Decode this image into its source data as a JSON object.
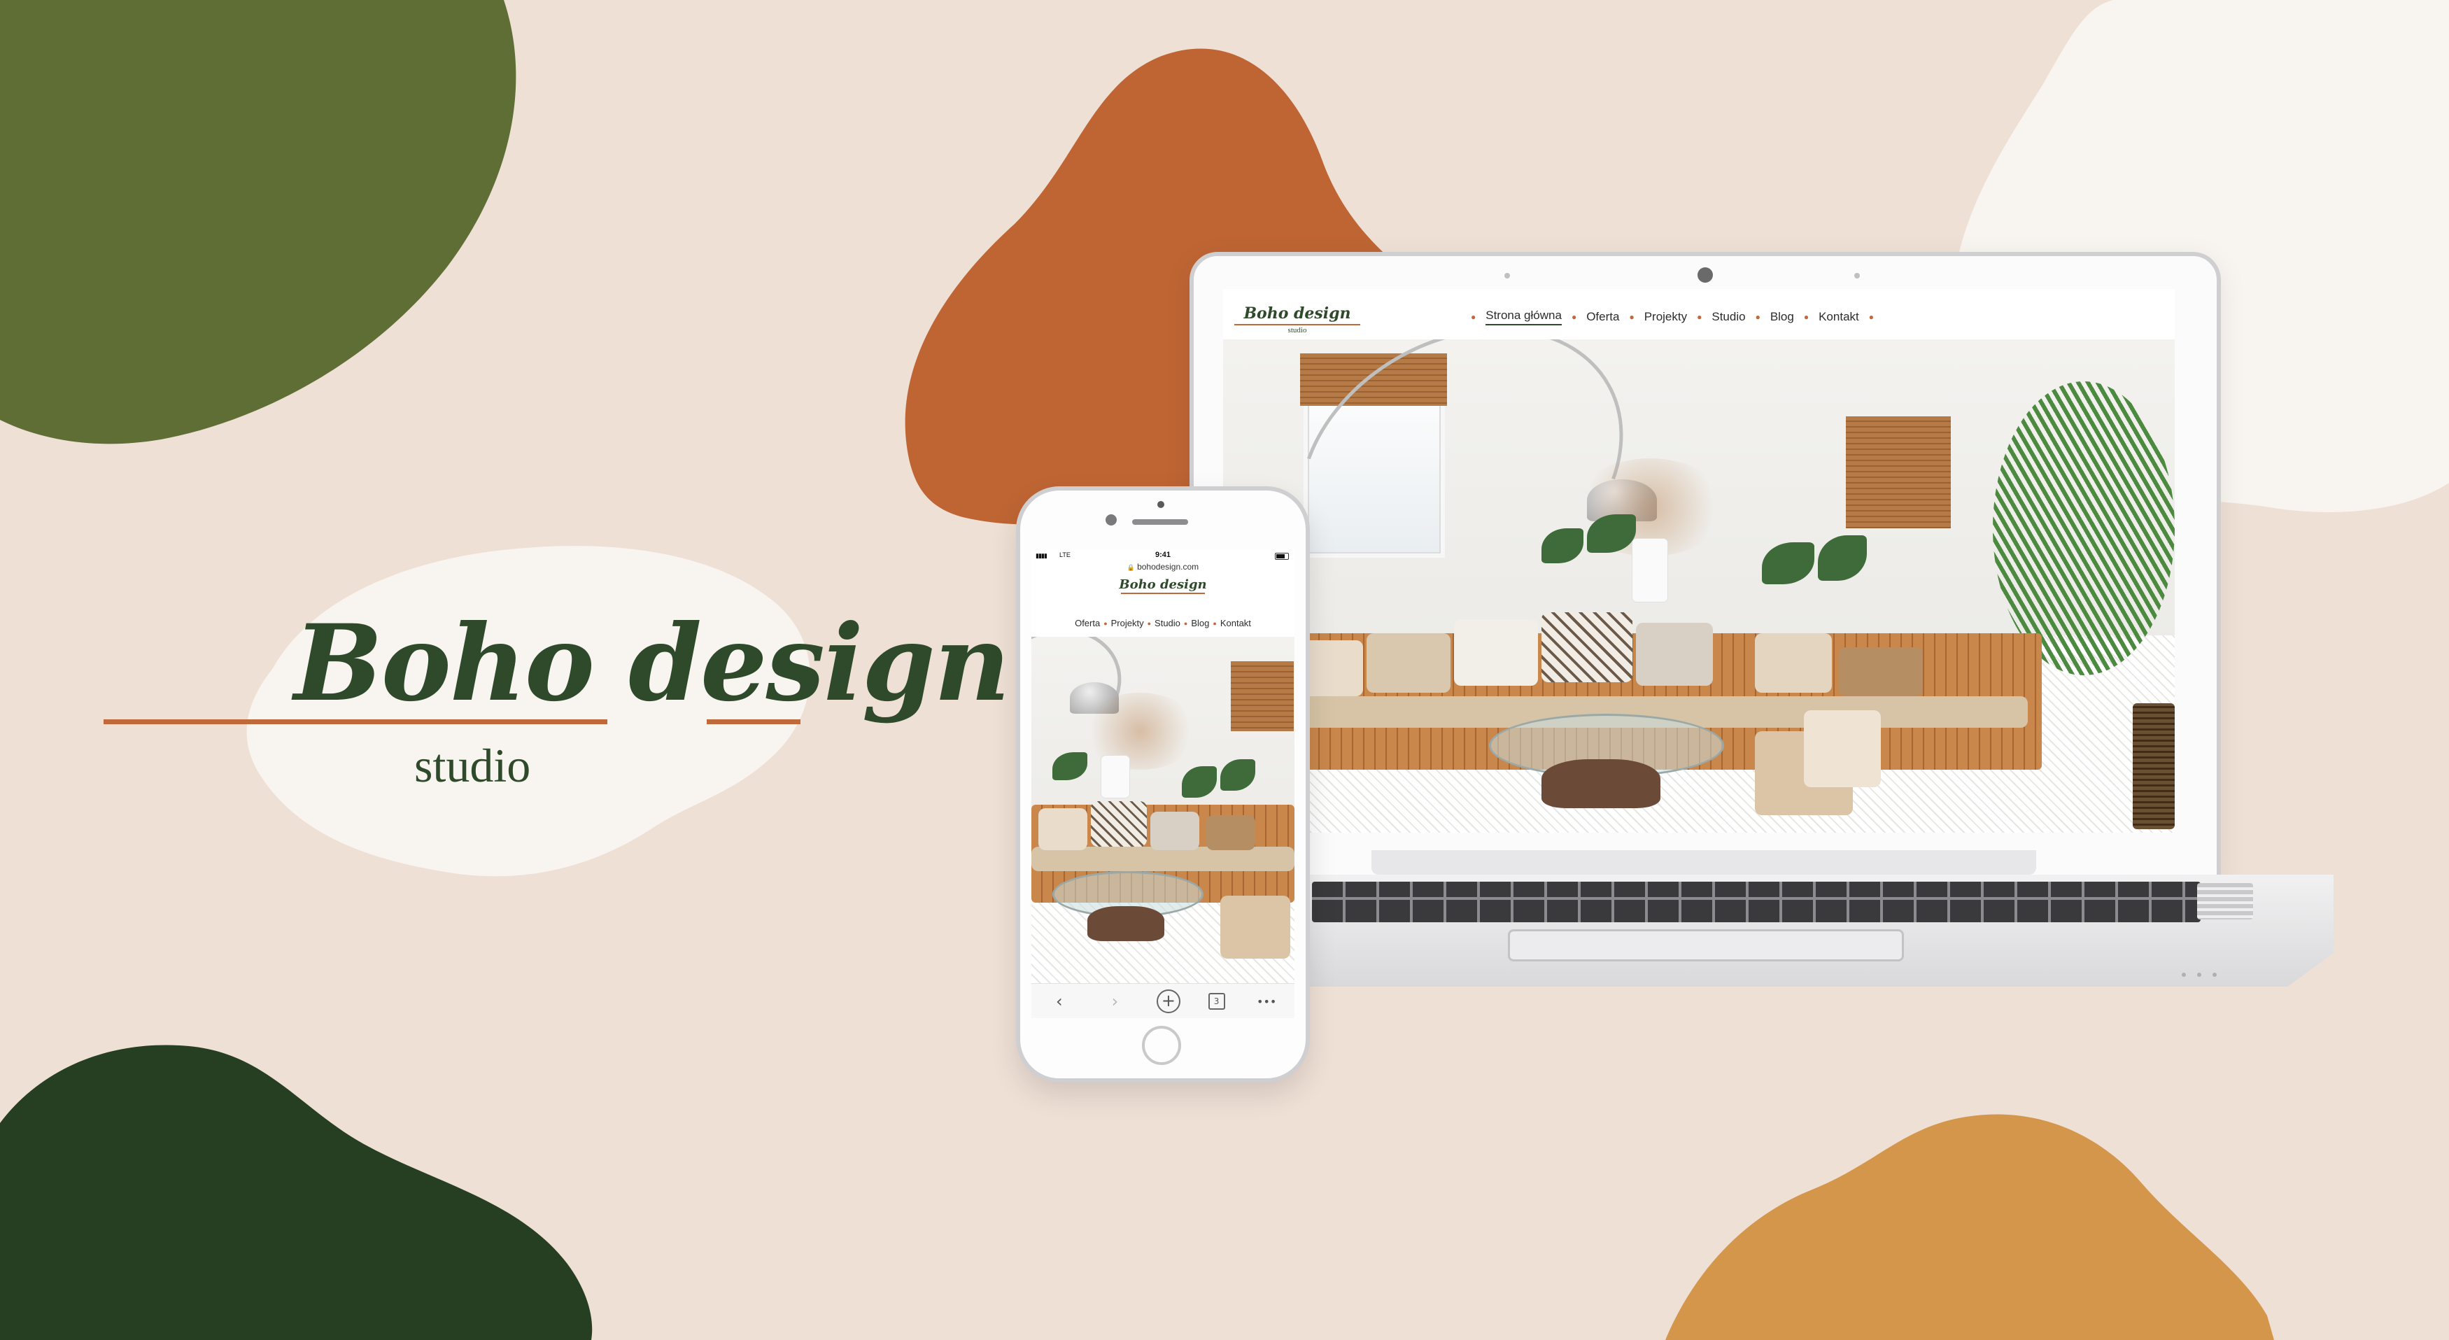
{
  "brand": {
    "name": "Boho design",
    "tagline": "studio",
    "colors": {
      "background": "#efe0d5",
      "olive": "#5f6e35",
      "forest": "#263f22",
      "rust": "#bf6534",
      "ochre": "#d4964b",
      "cream": "#f8f4ef",
      "accent_line": "#c0693a"
    }
  },
  "laptop_site": {
    "logo_title": "Boho design",
    "logo_subtitle": "studio",
    "nav": [
      {
        "label": "Strona główna",
        "active": true
      },
      {
        "label": "Oferta",
        "active": false
      },
      {
        "label": "Projekty",
        "active": false
      },
      {
        "label": "Studio",
        "active": false
      },
      {
        "label": "Blog",
        "active": false
      },
      {
        "label": "Kontakt",
        "active": false
      }
    ],
    "hero_image": "boho living room interior photo"
  },
  "phone_site": {
    "status": {
      "signal": "▮▮▮▮",
      "network": "LTE",
      "time": "9:41"
    },
    "url": "bohodesign.com",
    "logo_title": "Boho design",
    "nav": [
      {
        "label": "Oferta"
      },
      {
        "label": "Projekty"
      },
      {
        "label": "Studio"
      },
      {
        "label": "Blog"
      },
      {
        "label": "Kontakt"
      }
    ],
    "toolbar": {
      "back_icon": "‹",
      "forward_icon": "›",
      "new_tab_icon": "+",
      "tab_count": "3",
      "more_icon": "•••"
    }
  }
}
